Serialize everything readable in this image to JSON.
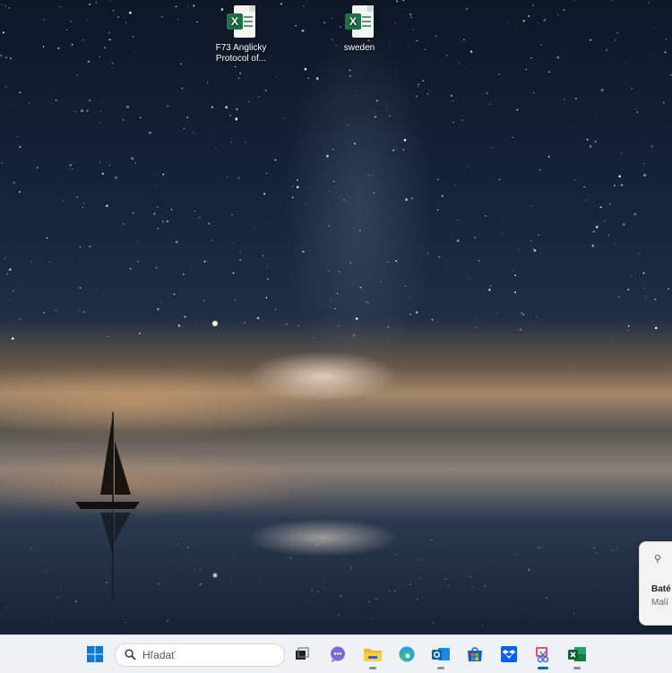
{
  "desktop": {
    "icons": [
      {
        "label_line1": "F73 Anglicky",
        "label_line2": "Protocol of...",
        "icon": "excel-file-icon"
      },
      {
        "label_line1": "sweden",
        "label_line2": "",
        "icon": "excel-file-icon"
      }
    ]
  },
  "notification": {
    "title": "Baté",
    "subtitle": "Malí",
    "icon": "location-pin-icon"
  },
  "taskbar": {
    "search_placeholder": "Hľadať",
    "apps": [
      {
        "name": "start",
        "icon": "windows-start-icon"
      },
      {
        "name": "task-view",
        "icon": "task-view-icon"
      },
      {
        "name": "chat",
        "icon": "chat-icon"
      },
      {
        "name": "file-explorer",
        "icon": "folder-icon"
      },
      {
        "name": "edge",
        "icon": "edge-icon"
      },
      {
        "name": "outlook",
        "icon": "outlook-icon"
      },
      {
        "name": "store",
        "icon": "store-icon"
      },
      {
        "name": "dropbox",
        "icon": "dropbox-icon"
      },
      {
        "name": "snipping-tool",
        "icon": "snipping-tool-icon",
        "active": true
      },
      {
        "name": "excel",
        "icon": "excel-icon"
      }
    ]
  },
  "colors": {
    "excel_green": "#1e7145",
    "accent": "#0067c0",
    "taskbar_bg": "#eef1f6"
  }
}
